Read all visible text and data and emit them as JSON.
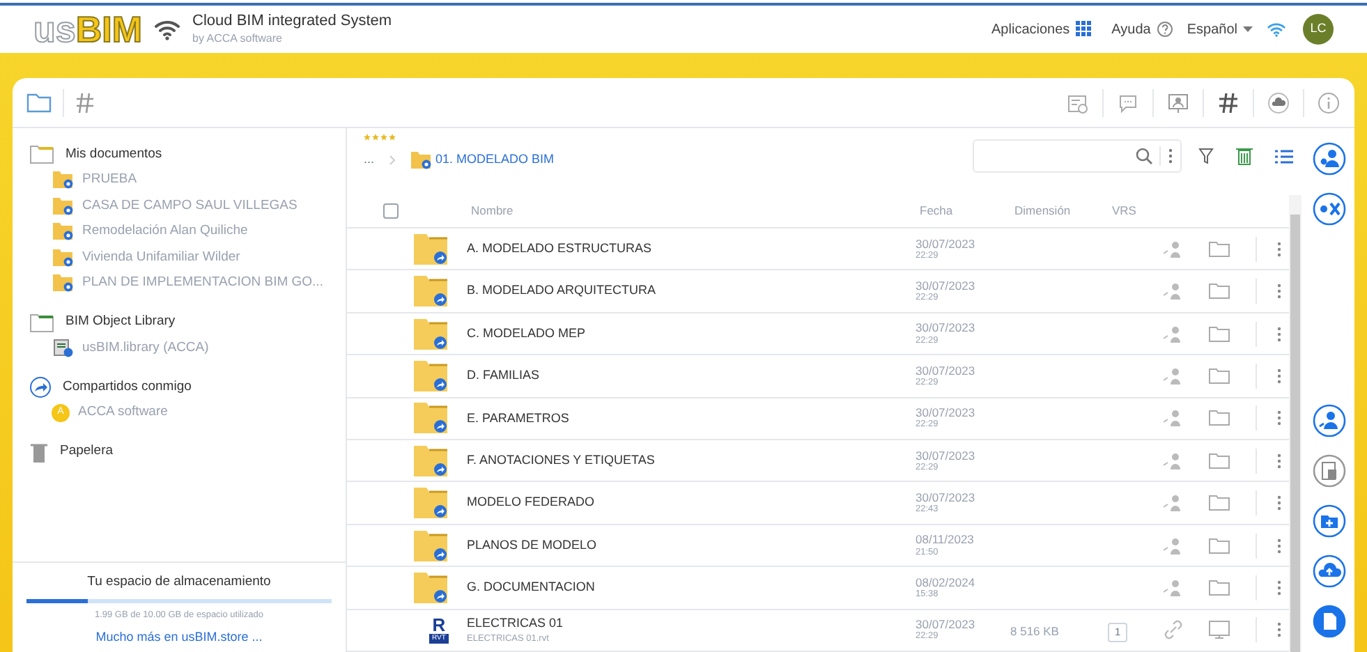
{
  "header": {
    "logo_light": "us",
    "logo_bold": "BIM",
    "title": "Cloud BIM integrated System",
    "subtitle": "by ACCA software",
    "apps": "Aplicaciones",
    "help": "Ayuda",
    "language": "Español",
    "avatar": "LC"
  },
  "sidebar": {
    "sections": [
      {
        "kind": "folder",
        "label": "Mis documentos",
        "children": [
          {
            "kind": "project",
            "label": "PRUEBA"
          },
          {
            "kind": "project",
            "label": "CASA DE CAMPO SAUL VILLEGAS"
          },
          {
            "kind": "project",
            "label": "Remodelación Alan Quiliche"
          },
          {
            "kind": "project",
            "label": "Vivienda Unifamiliar Wilder"
          },
          {
            "kind": "project",
            "label": "PLAN DE IMPLEMENTACION BIM GO..."
          }
        ]
      },
      {
        "kind": "library",
        "label": "BIM Object Library",
        "children": [
          {
            "kind": "library",
            "label": "usBIM.library (ACCA)"
          }
        ]
      },
      {
        "kind": "shared",
        "label": "Compartidos conmigo",
        "children": [
          {
            "kind": "user",
            "initial": "A",
            "label": "ACCA software"
          }
        ]
      },
      {
        "kind": "trash",
        "label": "Papelera"
      }
    ],
    "storage": {
      "title": "Tu espacio de almacenamiento",
      "level": 0.2,
      "usage": "1.99 GB de 10.00 GB de espacio utilizado",
      "link": "Mucho más en usBIM.store ..."
    }
  },
  "breadcrumb": {
    "stars": 4,
    "ellipsis": "...",
    "folder": "01. MODELADO BIM"
  },
  "table": {
    "select_all_checked": false,
    "columns": [
      "Nombre",
      "Fecha",
      "Dimensión",
      "VRS"
    ],
    "rows": [
      {
        "kind": "folder",
        "name": "A. MODELADO ESTRUCTURAS",
        "date": "30/07/2023",
        "time": "22:29"
      },
      {
        "kind": "folder",
        "name": "B. MODELADO ARQUITECTURA",
        "date": "30/07/2023",
        "time": "22:29"
      },
      {
        "kind": "folder",
        "name": "C. MODELADO MEP",
        "date": "30/07/2023",
        "time": "22:29"
      },
      {
        "kind": "folder",
        "name": "D. FAMILIAS",
        "date": "30/07/2023",
        "time": "22:29"
      },
      {
        "kind": "folder",
        "name": "E. PARAMETROS",
        "date": "30/07/2023",
        "time": "22:29"
      },
      {
        "kind": "folder",
        "name": "F. ANOTACIONES Y ETIQUETAS",
        "date": "30/07/2023",
        "time": "22:29"
      },
      {
        "kind": "folder",
        "name": "MODELO FEDERADO",
        "date": "30/07/2023",
        "time": "22:43"
      },
      {
        "kind": "folder",
        "name": "PLANOS DE MODELO",
        "date": "08/11/2023",
        "time": "21:50"
      },
      {
        "kind": "folder",
        "name": "G. DOCUMENTACION",
        "date": "08/02/2024",
        "time": "15:38"
      },
      {
        "kind": "file",
        "name": "ELECTRICAS 01",
        "file": "ELECTRICAS 01.rvt",
        "date": "30/07/2023",
        "time": "22:29",
        "size": "8 516 KB",
        "vrs": "1",
        "file_badge": "R",
        "file_ext": "RVT"
      }
    ]
  }
}
